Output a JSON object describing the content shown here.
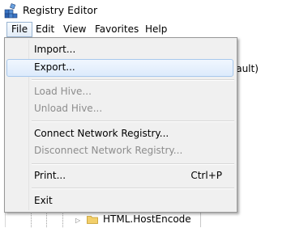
{
  "window": {
    "title": "Registry Editor"
  },
  "menubar": {
    "items": [
      {
        "label": "File"
      },
      {
        "label": "Edit"
      },
      {
        "label": "View"
      },
      {
        "label": "Favorites"
      },
      {
        "label": "Help"
      }
    ]
  },
  "file_menu": {
    "import": "Import...",
    "export": "Export...",
    "load_hive": "Load Hive...",
    "unload_hive": "Unload Hive...",
    "connect": "Connect Network Registry...",
    "disconnect": "Disconnect Network Registry...",
    "print": "Print...",
    "print_shortcut": "Ctrl+P",
    "exit": "Exit"
  },
  "right_pane": {
    "default_value_fragment": "fault)"
  },
  "tree": {
    "visible_key": "HTML.HostEncode"
  },
  "icons": {
    "app": "registry-editor-icon",
    "folder": "folder-icon",
    "expander": "expand-arrow-icon"
  },
  "colors": {
    "hover_border": "#a8c8ec",
    "menu_bg": "#f0f0f0",
    "disabled_text": "#8d8d8d"
  }
}
